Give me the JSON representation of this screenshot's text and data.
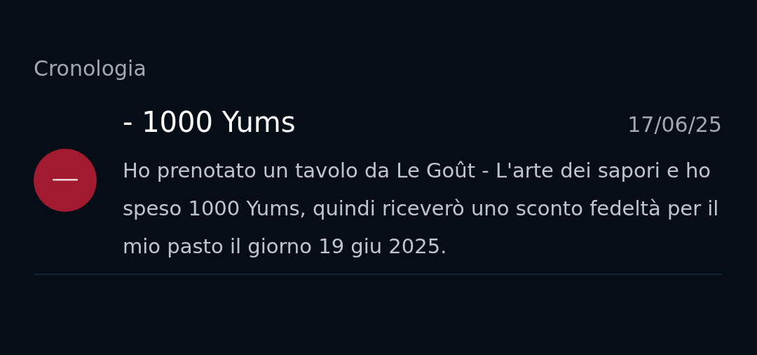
{
  "section_title": "Cronologia",
  "entries": [
    {
      "amount": "- 1000 Yums",
      "date": "17/06/25",
      "description": "Ho prenotato un tavolo da Le Goût - L'arte dei sapori e ho speso 1000 Yums, quindi riceverò uno sconto fedeltà per il mio pasto il giorno 19 giu 2025."
    }
  ]
}
